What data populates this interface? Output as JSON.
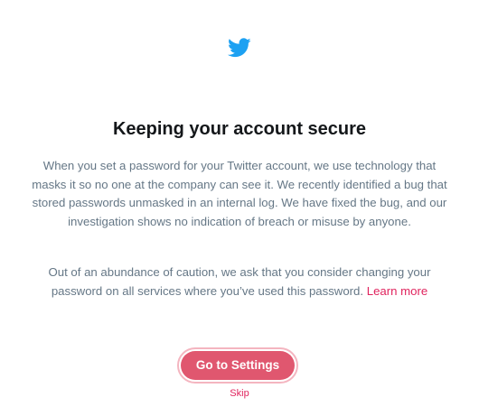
{
  "brand": {
    "icon": "twitter-bird-icon",
    "color": "#1da1f2"
  },
  "title": "Keeping your account secure",
  "paragraph1": "When you set a password for your Twitter account, we use technology that masks it so no one at the company can see it. We recently identified a bug that stored passwords unmasked in an internal log. We have fixed the bug, and our investigation shows no indication of breach or misuse by anyone.",
  "paragraph2": {
    "text": "Out of an abundance of caution, we ask that you consider changing your password on all services where you’ve used this password.",
    "link": "Learn more"
  },
  "actions": {
    "primary": "Go to Settings",
    "skip": "Skip"
  },
  "colors": {
    "primary_button": "#e0576f",
    "link": "#e0245e",
    "body_text": "#657786",
    "title_text": "#14171a"
  }
}
